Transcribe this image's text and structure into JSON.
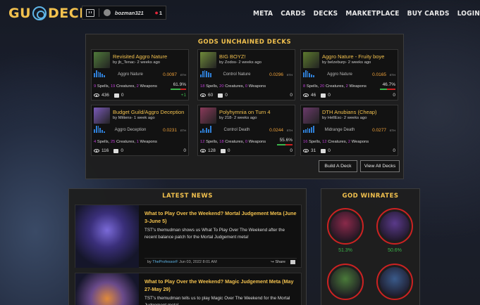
{
  "header": {
    "logo_left": "GU",
    "logo_right": "DECKS",
    "username": "bozman321",
    "notifications": "1",
    "nav": [
      "META",
      "CARDS",
      "DECKS",
      "MARKETPLACE",
      "BUY CARDS",
      "LOGIN"
    ]
  },
  "decks_panel": {
    "title": "GODS UNCHAINED DECKS",
    "eth_unit": "ETH",
    "decks": [
      {
        "title": "Revisited Aggro Nature",
        "by": "by jb_Tenac- 2 weeks ago",
        "archetype": "Aggro Nature",
        "cost": "0.0097",
        "spells": "9",
        "creatures": "19",
        "weapons": "2",
        "views": "436",
        "comments": "0",
        "winrate": "61.9%",
        "winrate_fraction": 0.62,
        "score": "+1",
        "thumb": "#4f7a3a",
        "bars": [
          5,
          9,
          7,
          6,
          4,
          2
        ]
      },
      {
        "title": "BIG BOYZ!",
        "by": "by Zodos- 2 weeks ago",
        "archetype": "Control Nature",
        "cost": "0.0296",
        "spells": "18",
        "creatures": "20",
        "weapons": "0",
        "views": "60",
        "comments": "0",
        "winrate": "",
        "winrate_fraction": 0,
        "score": "0",
        "thumb": "#6f8a3a",
        "bars": [
          3,
          8,
          9,
          8,
          6,
          5
        ]
      },
      {
        "title": "Aggro Nature - Fruity boye",
        "by": "by belzeburp- 2 weeks ago",
        "archetype": "Aggro Nature",
        "cost": "0.0165",
        "spells": "8",
        "creatures": "20",
        "weapons": "2",
        "views": "46",
        "comments": "0",
        "winrate": "46.7%",
        "winrate_fraction": 0.47,
        "score": "0",
        "thumb": "#5c7a2e",
        "bars": [
          6,
          9,
          8,
          5,
          3,
          2
        ]
      },
      {
        "title": "Budget Guild/Aggro Deception",
        "by": "by Mittens- 1 week ago",
        "archetype": "Aggro Deception",
        "cost": "0.0231",
        "spells": "4",
        "creatures": "25",
        "weapons": "1",
        "views": "116",
        "comments": "0",
        "winrate": "",
        "winrate_fraction": 0,
        "score": "0",
        "thumb": "#7a5ab8",
        "bars": [
          4,
          9,
          9,
          6,
          3,
          1
        ]
      },
      {
        "title": "Polyhymnia on Turn 4",
        "by": "by 218- 2 weeks ago",
        "archetype": "Control Death",
        "cost": "0.0244",
        "spells": "12",
        "creatures": "18",
        "weapons": "0",
        "views": "128",
        "comments": "0",
        "winrate": "55.6%",
        "winrate_fraction": 0.56,
        "score": "0",
        "thumb": "#8a3a5a",
        "bars": [
          2,
          5,
          3,
          6,
          4,
          9
        ]
      },
      {
        "title": "DTH Anubians (Cheap)",
        "by": "by HellEsc- 2 weeks ago",
        "archetype": "Midrange Death",
        "cost": "0.0277",
        "spells": "16",
        "creatures": "12",
        "weapons": "2",
        "views": "31",
        "comments": "0",
        "winrate": "",
        "winrate_fraction": 0,
        "score": "0",
        "thumb": "#6a3a6a",
        "bars": [
          3,
          4,
          6,
          5,
          7,
          9
        ]
      }
    ],
    "labels": {
      "spells": "Spells",
      "creatures": "Creatures",
      "weapons": "Weapons"
    },
    "build_button": "Build A Deck",
    "view_all_button": "View All Decks"
  },
  "news_panel": {
    "title": "LATEST NEWS",
    "items": [
      {
        "title": "What to Play Over the Weekend? Mortal Judgement Meta (June 3-June 5)",
        "desc": "TST's themudman shows us What To Play Over The Weekend after the recent balance patch for the Mortal Judgement meta!",
        "author": "TheProfessorF",
        "date": "Jun 03, 2022 8:01 AM",
        "share": "Share"
      },
      {
        "title": "What to Play Over the Weekend? Magic Judgement Meta (May 27-May 29)",
        "desc": "TST's themudman tells us to play Magic Over The Weekend for the Mortal Judgement meta!",
        "author": "",
        "date": "",
        "share": ""
      }
    ],
    "meta_by": "by"
  },
  "god_panel": {
    "title": "GOD WINRATES",
    "gods": [
      {
        "rate": "51.3%",
        "color": "#8a2a4a"
      },
      {
        "rate": "50.6%",
        "color": "#5a3a8a"
      },
      {
        "rate": "",
        "color": "#4a7a3a"
      },
      {
        "rate": "",
        "color": "#3a5a8a"
      }
    ]
  }
}
